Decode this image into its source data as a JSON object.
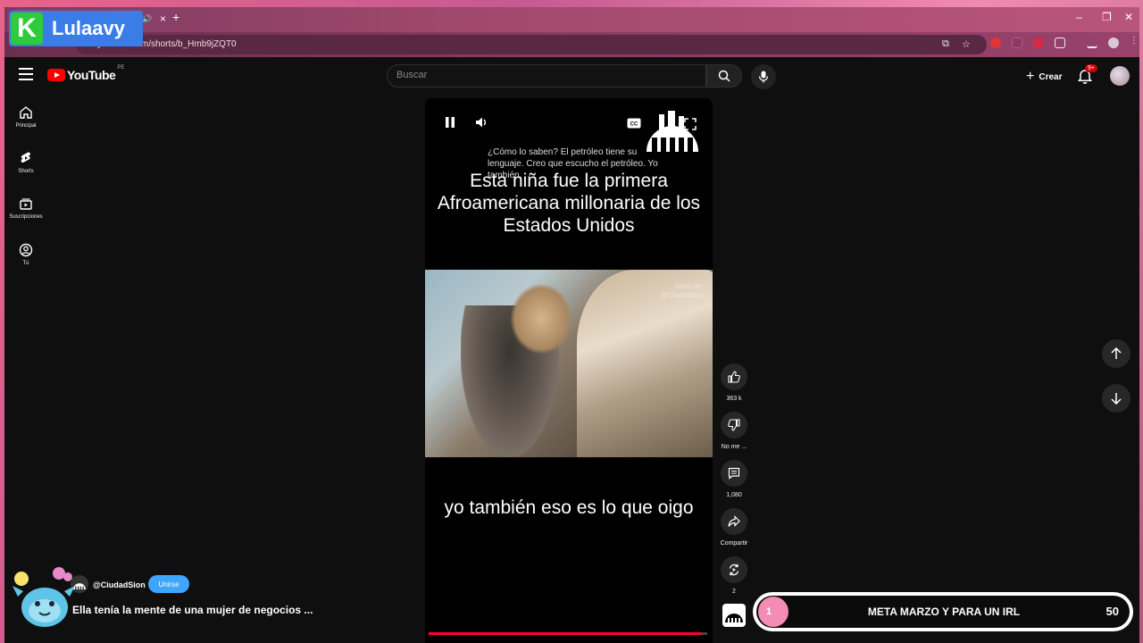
{
  "browser": {
    "url": "youtube.com/shorts/b_Hmb9jZQT0",
    "new_tab_label": "+",
    "tab_close": "×",
    "window_controls": [
      "–",
      "❐",
      "✕"
    ]
  },
  "stream_overlay": {
    "logo_letter": "K",
    "logo_name": "Lulaavy",
    "goal": {
      "count": "1",
      "title": "META MARZO Y PARA UN IRL",
      "target": "50"
    }
  },
  "youtube": {
    "logo_text": "YouTube",
    "country": "PE",
    "search_placeholder": "Buscar",
    "create_label": "Crear",
    "notification_badge": "9+",
    "sidebar": [
      {
        "label": "Principal",
        "icon": "home-icon"
      },
      {
        "label": "Shorts",
        "icon": "shorts-icon"
      },
      {
        "label": "Suscripciones",
        "icon": "subscriptions-icon"
      },
      {
        "label": "Tú",
        "icon": "you-icon"
      }
    ]
  },
  "video": {
    "caption_top": "¿Cómo lo saben? El petróleo tiene su lenguaje. Creo que escucho el petróleo. Yo también.",
    "headline": "Esta niña fue la primera Afroamericana millonaria de los Estados Unidos",
    "credit": "Video de:\n@Ciudadsion",
    "subtitle": "yo también eso es lo que oigo",
    "progress": 0.98,
    "channel": "@CiudadSion",
    "join_label": "Unirse",
    "title": "Ella tenía la mente de una mujer de negocios ..."
  },
  "actions": {
    "likes": "363 k",
    "dislike": "No me ...",
    "comments": "1,080",
    "share": "Compartir",
    "remix": "2"
  },
  "colors": {
    "accent_red": "#ff0033",
    "join_blue": "#3ea6ff",
    "goal_pink": "#f48cb6"
  }
}
